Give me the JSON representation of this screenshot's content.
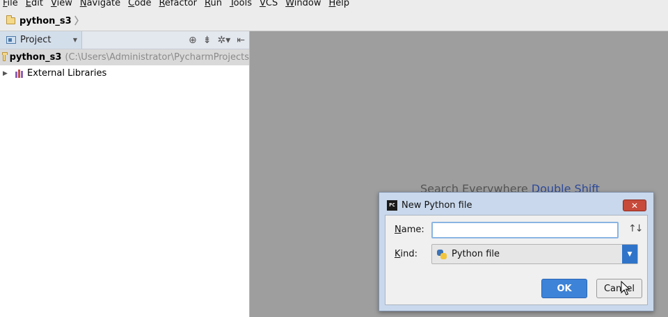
{
  "menu": [
    "File",
    "Edit",
    "View",
    "Navigate",
    "Code",
    "Refactor",
    "Run",
    "Tools",
    "VCS",
    "Window",
    "Help"
  ],
  "navbar": {
    "crumb": "python_s3",
    "separator": "〉"
  },
  "project_panel": {
    "selector_label": "Project",
    "dropdown_glyph": "▼",
    "tools": [
      "⊕",
      "⇟",
      "✲▾",
      "⇤"
    ],
    "tree": [
      {
        "name": "python_s3",
        "path": "(C:\\Users\\Administrator\\PycharmProjects"
      },
      {
        "name": "External Libraries",
        "expander": "▶"
      }
    ]
  },
  "editor": {
    "hint_text": "Search Everywhere ",
    "hint_key": "Double Shift"
  },
  "dialog": {
    "title": "New Python file",
    "icon_text": "PC",
    "close_glyph": "✕",
    "name_label": "Name:",
    "name_value": "",
    "sort_glyph": "↑↓",
    "kind_label": "Kind:",
    "kind_value": "Python file",
    "kind_dropdown_glyph": "▼",
    "ok_label": "OK",
    "cancel_label": "Cancel"
  },
  "colors": {
    "accent": "#3d83d8",
    "close": "#c74a3a",
    "folder": "#f4d98a"
  }
}
